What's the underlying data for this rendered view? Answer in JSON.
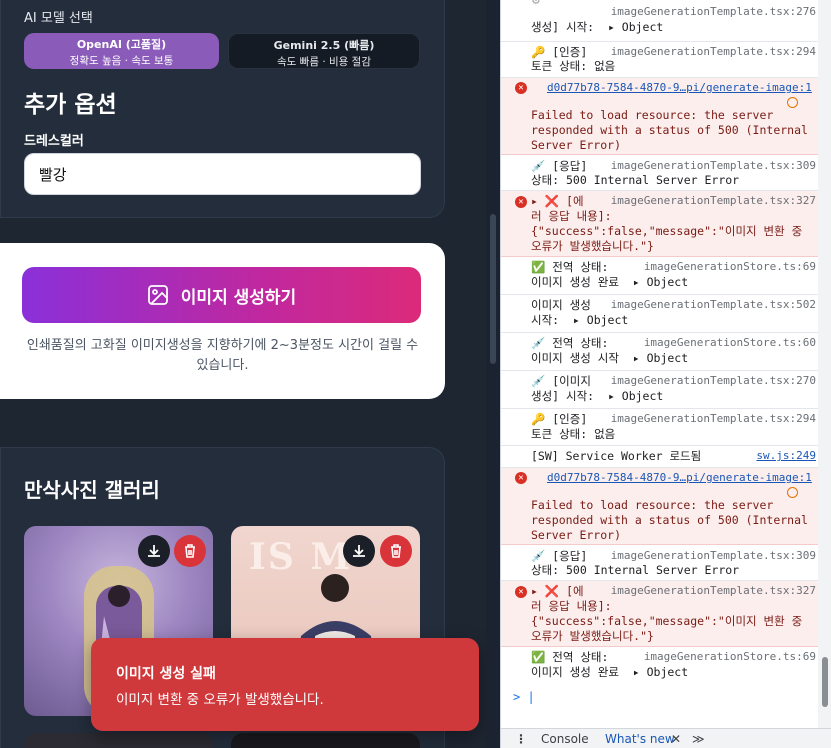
{
  "app": {
    "ai_model_label": "AI 모델 선택",
    "models": [
      {
        "name": "OpenAI (고품질)",
        "desc": "정확도 높음 · 속도 보통"
      },
      {
        "name": "Gemini 2.5 (빠름)",
        "desc": "속도 빠름 · 비용 절감"
      }
    ],
    "extra_options_title": "추가 옵션",
    "dress_color_label": "드레스컬러",
    "dress_color_value": "빨강",
    "generate_label": "이미지 생성하기",
    "generate_note": "인쇄품질의 고화질 이미지생성을 지향하기에 2~3분정도 시간이 걸릴 수 있습니다.",
    "gallery_title": "만삭사진 갤러리",
    "thumb2_text": "IS M",
    "toast_title": "이미지 생성 실패",
    "toast_message": "이미지 변환 중 오류가 발생했습니다.",
    "colors": {
      "primary_gradient_start": "#8a30d9",
      "primary_gradient_end": "#dc2a7a",
      "toast": "#d0393c"
    }
  },
  "devtools": {
    "rows": [
      {
        "text": "생성] 시작:  ▸ Object",
        "src": "imageGenerationTemplate.tsx:276"
      },
      {
        "text": "🔑 [인증]",
        "text2": "토큰 상태: 없음",
        "src": "imageGenerationTemplate.tsx:294"
      },
      {
        "link": "d0d77b78-7584-4870-9…pi/generate-image:1",
        "text": "Failed to load resource: the server\nresponded with a status of 500 (Internal\nServer Error)"
      },
      {
        "text": "💉 [응답]",
        "text2": "상태: 500 Internal Server Error",
        "src": "imageGenerationTemplate.tsx:309"
      },
      {
        "text": "▸ ❌ [에",
        "text2": "러 응답 내용]:\n{\"success\":false,\"message\":\"이미지 변환 중\n오류가 발생했습니다.\"}",
        "src": "imageGenerationTemplate.tsx:327"
      },
      {
        "text": "✅ 전역 상태:",
        "text2": "이미지 생성 완료  ▸ Object",
        "src": "imageGenerationStore.ts:69"
      },
      {
        "text": "이미지 생성",
        "text2": "시작:  ▸ Object",
        "src": "imageGenerationTemplate.tsx:502"
      },
      {
        "text": "💉 전역 상태:",
        "text2": "이미지 생성 시작  ▸ Object",
        "src": "imageGenerationStore.ts:60"
      },
      {
        "text": "💉 [이미지",
        "text2": "생성] 시작:  ▸ Object",
        "src": "imageGenerationTemplate.tsx:270"
      },
      {
        "text": "🔑 [인증]",
        "text2": "토큰 상태: 없음",
        "src": "imageGenerationTemplate.tsx:294"
      },
      {
        "text": "[SW] Service Worker 로드됨",
        "src": "sw.js:249"
      },
      {
        "link": "d0d77b78-7584-4870-9…pi/generate-image:1",
        "text": "Failed to load resource: the server\nresponded with a status of 500 (Internal\nServer Error)"
      },
      {
        "text": "💉 [응답]",
        "text2": "상태: 500 Internal Server Error",
        "src": "imageGenerationTemplate.tsx:309"
      },
      {
        "text": "▸ ❌ [에",
        "text2": "러 응답 내용]:\n{\"success\":false,\"message\":\"이미지 변환 중\n오류가 발생했습니다.\"}",
        "src": "imageGenerationTemplate.tsx:327"
      },
      {
        "text": "✅ 전역 상태:",
        "text2": "이미지 생성 완료  ▸ Object",
        "src": "imageGenerationStore.ts:69"
      }
    ],
    "prompt": "> |",
    "tabs": {
      "menu": "⋮",
      "console": "Console",
      "whatsnew": "What's new",
      "close": "✕",
      "more": "≫"
    }
  }
}
